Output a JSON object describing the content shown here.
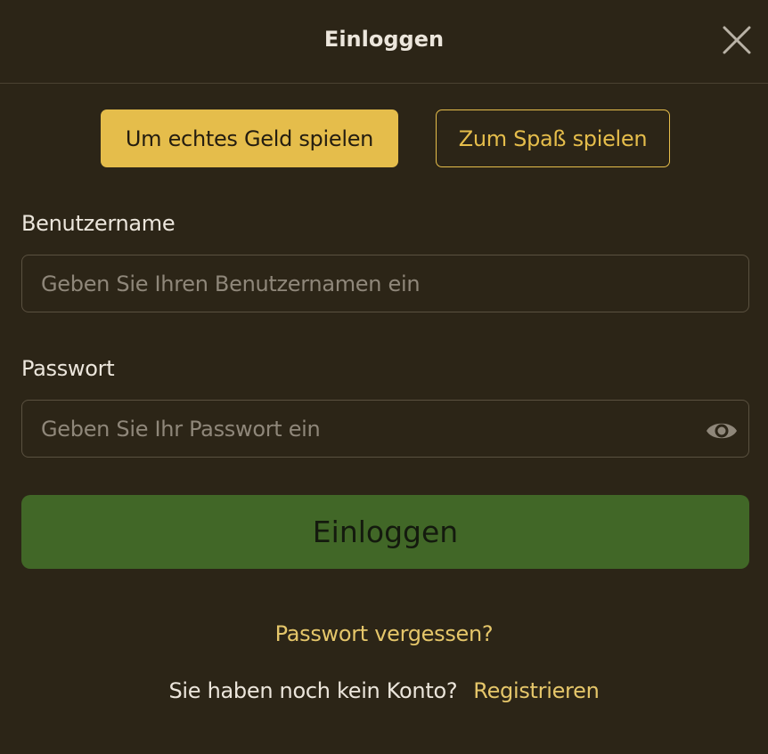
{
  "dialog": {
    "title": "Einloggen"
  },
  "modes": {
    "real_money": "Um echtes Geld spielen",
    "for_fun": "Zum Spaß spielen"
  },
  "username": {
    "label": "Benutzername",
    "placeholder": "Geben Sie Ihren Benutzernamen ein",
    "value": ""
  },
  "password": {
    "label": "Passwort",
    "placeholder": "Geben Sie Ihr Passwort ein",
    "value": ""
  },
  "actions": {
    "login": "Einloggen",
    "forgot_password": "Passwort vergessen?",
    "no_account": "Sie haben noch kein Konto?",
    "register": "Registrieren"
  },
  "icons": {
    "close": "close-icon",
    "show_password": "eye-icon"
  },
  "colors": {
    "background": "#2c2517",
    "accent": "#e5bd4b",
    "link": "#e5c66a",
    "primary_button": "#416727",
    "text": "#ece6dc",
    "placeholder": "#8f877a"
  }
}
